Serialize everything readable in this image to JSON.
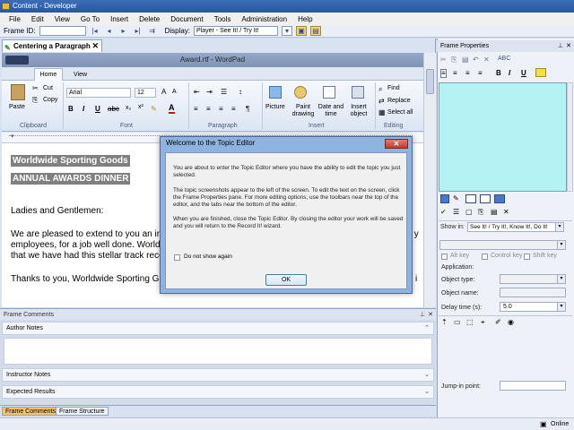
{
  "window": {
    "title": "Content - Developer"
  },
  "menu": [
    "File",
    "Edit",
    "View",
    "Go To",
    "Insert",
    "Delete",
    "Document",
    "Tools",
    "Administration",
    "Help"
  ],
  "toolbar": {
    "frame_id_label": "Frame ID:",
    "display_label": "Display:",
    "display_value": "Player - See It! / Try It!"
  },
  "doc_tab": {
    "label": "Centering a Paragraph"
  },
  "wordpad": {
    "title": "Award.rtf - WordPad",
    "tabs": [
      "Home",
      "View"
    ],
    "clipboard": {
      "paste": "Paste",
      "cut": "Cut",
      "copy": "Copy",
      "group": "Clipboard"
    },
    "font": {
      "name": "Arial",
      "size": "12",
      "group": "Font"
    },
    "paragraph": {
      "group": "Paragraph"
    },
    "insert": {
      "picture": "Picture",
      "paint": "Paint drawing",
      "datetime": "Date and time",
      "object": "Insert object",
      "group": "Insert"
    },
    "editing": {
      "find": "Find",
      "replace": "Replace",
      "selectall": "Select all",
      "group": "Editing"
    }
  },
  "document": {
    "line1": "Worldwide Sporting Goods",
    "line2": "ANNUAL AWARDS DINNER",
    "line3": "Ladies and Gentlemen:",
    "line4": "We are pleased to extend to you an inv",
    "line4_tail": "k y",
    "line5": "employees, for a job well done.  World",
    "line6": "that we have had this stellar track reco",
    "line7": "Thanks to you, Worldwide Sporting Go",
    "line7_tail": "l i"
  },
  "frame_comments": {
    "header": "Frame Comments",
    "author_notes": "Author Notes",
    "instructor_notes": "Instructor Notes",
    "expected_results": "Expected Results"
  },
  "bottom_tabs": [
    "Frame Comments",
    "Frame Structure"
  ],
  "frame_properties": {
    "header": "Frame Properties",
    "show_in_label": "Show in:",
    "show_in_value": "See It! / Try It!, Know It!, Do It!",
    "alt_key": "Alt key",
    "control_key": "Control key",
    "shift_key": "Shift key",
    "application": "Application:",
    "object_type": "Object type:",
    "object_name": "Object name:",
    "delay_time": "Delay time (s):",
    "delay_value": "5.0",
    "jump_in": "Jump-in point:"
  },
  "dialog": {
    "title": "Welcome to the Topic Editor",
    "p1": "You are about to enter the Topic Editor where you have the ability to edit the topic you just selected.",
    "p2": "The topic screenshots appear to the left of the screen. To edit the text on the screen, click the Frame Properties pane. For more editing options, use the toolbars near the top of the editor, and the tabs near the bottom of the editor.",
    "p3": "When you are finished, close the Topic Editor. By closing the editor your work will be saved and you will return to the Record It! wizard.",
    "checkbox": "Do not show again",
    "ok": "OK"
  },
  "status": {
    "online": "Online"
  }
}
